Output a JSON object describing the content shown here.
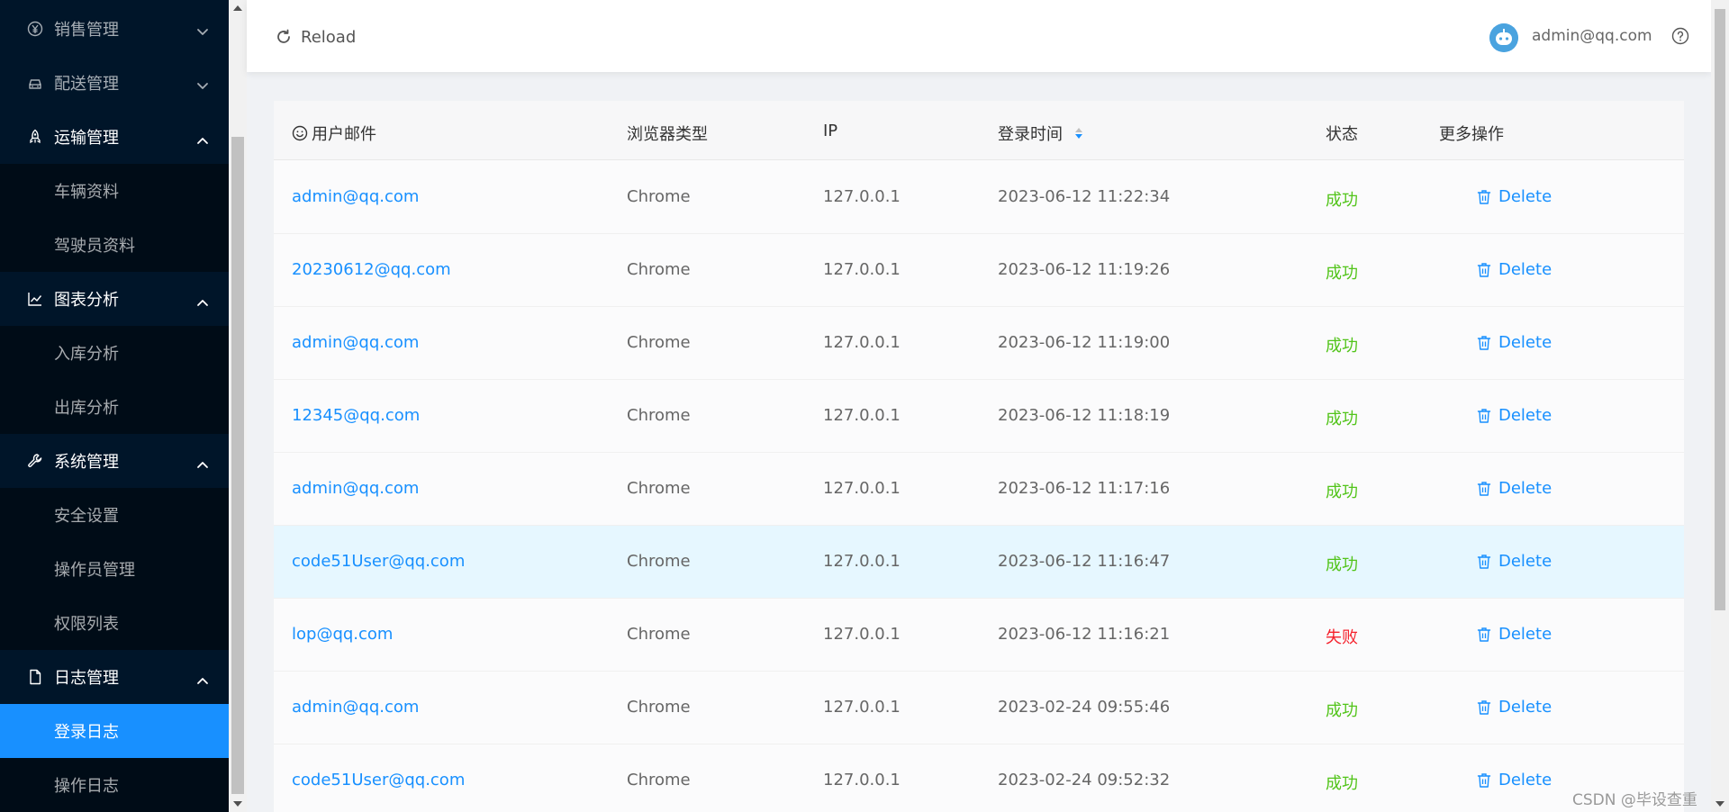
{
  "sidebar": {
    "items": [
      {
        "label": "销售管理",
        "icon": "yen-circle-icon",
        "type": "group",
        "expanded": false
      },
      {
        "label": "配送管理",
        "icon": "car-icon",
        "type": "group",
        "expanded": false
      },
      {
        "label": "运输管理",
        "icon": "rocket-icon",
        "type": "group",
        "expanded": true
      },
      {
        "label": "车辆资料",
        "type": "sub"
      },
      {
        "label": "驾驶员资料",
        "type": "sub"
      },
      {
        "label": "图表分析",
        "icon": "line-chart-icon",
        "type": "group",
        "expanded": true
      },
      {
        "label": "入库分析",
        "type": "sub"
      },
      {
        "label": "出库分析",
        "type": "sub"
      },
      {
        "label": "系统管理",
        "icon": "tool-icon",
        "type": "group",
        "expanded": true
      },
      {
        "label": "安全设置",
        "type": "sub"
      },
      {
        "label": "操作员管理",
        "type": "sub"
      },
      {
        "label": "权限列表",
        "type": "sub"
      },
      {
        "label": "日志管理",
        "icon": "file-icon",
        "type": "group",
        "expanded": true
      },
      {
        "label": "登录日志",
        "type": "sub",
        "active": true
      },
      {
        "label": "操作日志",
        "type": "sub"
      }
    ]
  },
  "header": {
    "reload_label": "Reload",
    "user_email": "admin@qq.com"
  },
  "table": {
    "columns": {
      "email": "用户邮件",
      "browser": "浏览器类型",
      "ip": "IP",
      "login_time": "登录时间",
      "status": "状态",
      "actions": "更多操作"
    },
    "delete_label": "Delete",
    "rows": [
      {
        "email": "admin@qq.com",
        "browser": "Chrome",
        "ip": "127.0.0.1",
        "time": "2023-06-12 11:22:34",
        "status": "成功",
        "ok": true
      },
      {
        "email": "20230612@qq.com",
        "browser": "Chrome",
        "ip": "127.0.0.1",
        "time": "2023-06-12 11:19:26",
        "status": "成功",
        "ok": true
      },
      {
        "email": "admin@qq.com",
        "browser": "Chrome",
        "ip": "127.0.0.1",
        "time": "2023-06-12 11:19:00",
        "status": "成功",
        "ok": true
      },
      {
        "email": "12345@qq.com",
        "browser": "Chrome",
        "ip": "127.0.0.1",
        "time": "2023-06-12 11:18:19",
        "status": "成功",
        "ok": true
      },
      {
        "email": "admin@qq.com",
        "browser": "Chrome",
        "ip": "127.0.0.1",
        "time": "2023-06-12 11:17:16",
        "status": "成功",
        "ok": true
      },
      {
        "email": "code51User@qq.com",
        "browser": "Chrome",
        "ip": "127.0.0.1",
        "time": "2023-06-12 11:16:47",
        "status": "成功",
        "ok": true,
        "highlight": true
      },
      {
        "email": "lop@qq.com",
        "browser": "Chrome",
        "ip": "127.0.0.1",
        "time": "2023-06-12 11:16:21",
        "status": "失败",
        "ok": false
      },
      {
        "email": "admin@qq.com",
        "browser": "Chrome",
        "ip": "127.0.0.1",
        "time": "2023-02-24 09:55:46",
        "status": "成功",
        "ok": true
      },
      {
        "email": "code51User@qq.com",
        "browser": "Chrome",
        "ip": "127.0.0.1",
        "time": "2023-02-24 09:52:32",
        "status": "成功",
        "ok": true
      }
    ]
  },
  "watermark": "CSDN @毕设查重",
  "colors": {
    "sidebar_bg": "#001529",
    "accent": "#1890ff",
    "success": "#52c41a",
    "fail": "#f5222d"
  }
}
